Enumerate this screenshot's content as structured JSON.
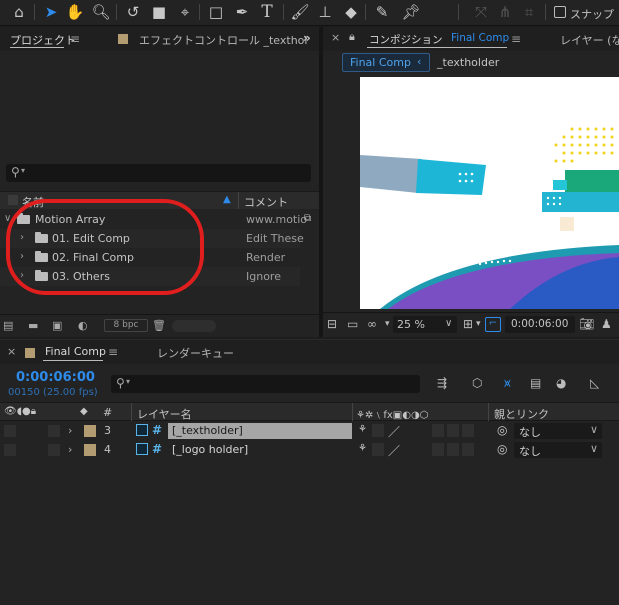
{
  "toolbar": {
    "snap_label": "スナップ",
    "icons": [
      "home-icon",
      "selection-tool-icon",
      "hand-tool-icon",
      "zoom-tool-icon",
      "rotate-tool-icon",
      "camera-tool-icon",
      "pan-behind-tool-icon",
      "rectangle-tool-icon",
      "pen-tool-icon",
      "type-tool-icon",
      "brush-tool-icon",
      "clone-stamp-icon",
      "eraser-icon",
      "roto-brush-icon",
      "puppet-pin-icon"
    ]
  },
  "project_panel": {
    "tab_project": "プロジェクト",
    "tab_effect_controls": "エフェクトコントロール _texthol",
    "search_placeholder": "",
    "column_name": "名前",
    "column_comment": "コメント",
    "rows": [
      {
        "name": "Motion Array",
        "comment": "www.motio",
        "level": 0,
        "expanded": true
      },
      {
        "name": "01. Edit Comp",
        "comment": "Edit These",
        "level": 1,
        "expanded": false
      },
      {
        "name": "02. Final Comp",
        "comment": "Render",
        "level": 1,
        "expanded": false
      },
      {
        "name": "03. Others",
        "comment": "Ignore",
        "level": 1,
        "expanded": false
      }
    ],
    "bpc_label": "8 bpc"
  },
  "comp_panel": {
    "tab_prefix": "コンポジション",
    "tab_comp_name": "Final Comp",
    "tab_layer": "レイヤー (なし",
    "breadcrumb_active": "Final Comp",
    "breadcrumb_next": "_textholder",
    "zoom": "25 %",
    "timecode": "0:00:06:00"
  },
  "timeline": {
    "tab_comp": "Final Comp",
    "tab_render_queue": "レンダーキュー",
    "timecode": "0:00:06:00",
    "frame_info": "00150 (25.00 fps)",
    "search_placeholder": "",
    "header_hash": "#",
    "header_layer_name": "レイヤー名",
    "header_parent": "親とリンク",
    "layers": [
      {
        "number": "3",
        "name": "[_textholder]",
        "parent": "なし",
        "selected": true,
        "label_color": "#b39b72"
      },
      {
        "number": "4",
        "name": "[_logo holder]",
        "parent": "なし",
        "selected": false,
        "label_color": "#b39b72"
      }
    ]
  },
  "colors": {
    "accent_blue": "#2d8ceb",
    "highlight_ring": "#e01e1e",
    "comp_label": "#b39b72"
  }
}
